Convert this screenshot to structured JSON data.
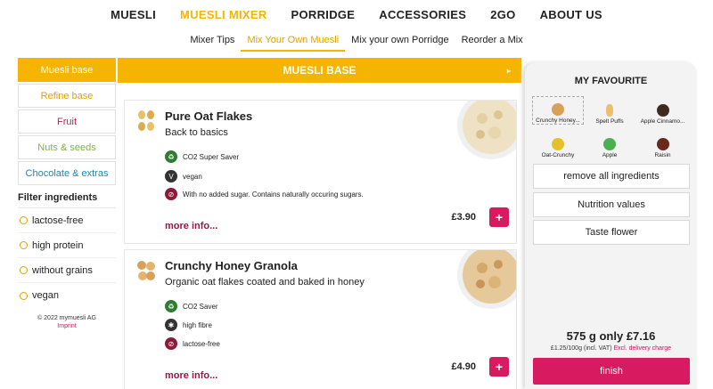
{
  "nav": {
    "items": [
      {
        "label": "MUESLI",
        "active": false
      },
      {
        "label": "MUESLI MIXER",
        "active": true
      },
      {
        "label": "PORRIDGE",
        "active": false
      },
      {
        "label": "ACCESSORIES",
        "active": false
      },
      {
        "label": "2GO",
        "active": false
      },
      {
        "label": "ABOUT US",
        "active": false
      }
    ]
  },
  "subnav": {
    "items": [
      {
        "label": "Mixer Tips",
        "active": false
      },
      {
        "label": "Mix Your Own Muesli",
        "active": true
      },
      {
        "label": "Mix your own Porridge",
        "active": false
      },
      {
        "label": "Reorder a Mix",
        "active": false
      }
    ]
  },
  "sidebar": {
    "categories": [
      {
        "label": "Muesli base",
        "active": true
      },
      {
        "label": "Refine base",
        "active": false
      },
      {
        "label": "Fruit",
        "active": false
      },
      {
        "label": "Nuts & seeds",
        "active": false
      },
      {
        "label": "Chocolate & extras",
        "active": false
      }
    ],
    "filter_title": "Filter ingredients",
    "filters": [
      {
        "label": "lactose-free"
      },
      {
        "label": "high protein"
      },
      {
        "label": "without grains"
      },
      {
        "label": "vegan"
      }
    ],
    "copyright": "© 2022 mymuesli AG",
    "imprint": "Imprint"
  },
  "main": {
    "header": "MUESLI BASE",
    "header_arrow": "▸",
    "products": [
      {
        "name": "Pure Oat Flakes",
        "description": "Back to basics",
        "attributes": [
          {
            "icon": "co2-icon",
            "label": "CO2 Super Saver",
            "color": "#2e7d32"
          },
          {
            "icon": "vegan-icon",
            "label": "vegan",
            "color": "#333333"
          },
          {
            "icon": "no-sugar-icon",
            "label": "With no added sugar. Contains naturally occuring sugars.",
            "color": "#8e1a3a"
          }
        ],
        "more_label": "more info...",
        "price": "£3.90",
        "add_label": "+"
      },
      {
        "name": "Crunchy Honey Granola",
        "description": "Organic oat flakes coated and baked in honey",
        "attributes": [
          {
            "icon": "co2-icon",
            "label": "CO2 Saver",
            "color": "#2e7d32"
          },
          {
            "icon": "high-fibre-icon",
            "label": "high fibre",
            "color": "#333333"
          },
          {
            "icon": "lactose-free-icon",
            "label": "lactose-free",
            "color": "#8e1a3a"
          }
        ],
        "more_label": "more info...",
        "price": "£4.90",
        "add_label": "+"
      }
    ]
  },
  "favourite": {
    "title": "MY FAVOURITE",
    "ingredients": [
      {
        "label": "Crunchy Honey...",
        "icon": "granola-icon",
        "color": "#d8a15a",
        "selected": true
      },
      {
        "label": "Spelt Puffs",
        "icon": "spelt-puff-icon",
        "color": "#e8c070",
        "selected": false
      },
      {
        "label": "Apple Cinnamo...",
        "icon": "apple-cinnamon-icon",
        "color": "#3e2a1e",
        "selected": false
      },
      {
        "label": "Oat-Crunchy",
        "icon": "oat-crunchy-icon",
        "color": "#e6c028",
        "selected": false
      },
      {
        "label": "Apple",
        "icon": "apple-icon",
        "color": "#4caf50",
        "selected": false
      },
      {
        "label": "Raisin",
        "icon": "raisin-icon",
        "color": "#6a2a1a",
        "selected": false
      }
    ],
    "buttons": {
      "remove_all": "remove all ingredients",
      "nutrition": "Nutrition values",
      "taste": "Taste flower"
    },
    "total": "575 g only £7.16",
    "per_100g": "£1.25/100g (incl. VAT)",
    "excl_delivery": "Excl. delivery charge",
    "finish": "finish"
  },
  "colors": {
    "accent": "#f5b400",
    "primary_button": "#d81b60"
  }
}
